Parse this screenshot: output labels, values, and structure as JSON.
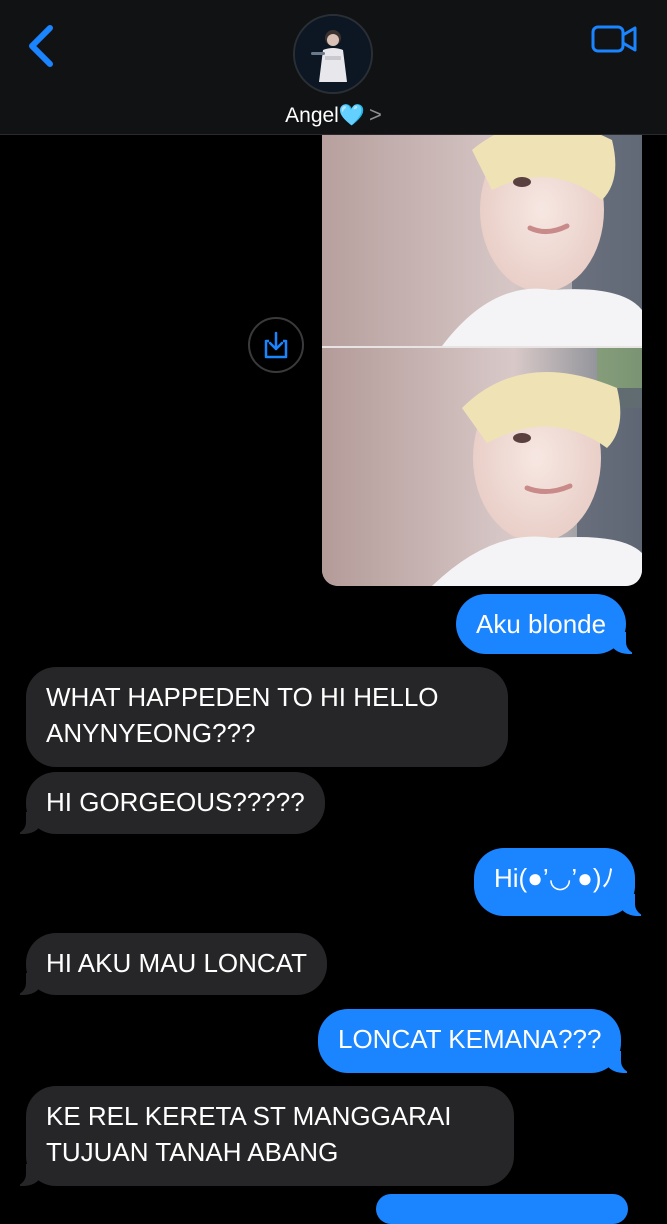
{
  "header": {
    "contact_name": "Angel🩵",
    "chevron": ">",
    "accent_color": "#1b84ff"
  },
  "icons": {
    "back": "chevron-left-icon",
    "video": "video-camera-icon",
    "download": "share-download-icon"
  },
  "messages": [
    {
      "side": "out",
      "text": "Aku blonde"
    },
    {
      "side": "in",
      "text": "WHAT HAPPEDEN TO HI HELLO ANYNYEONG???"
    },
    {
      "side": "in",
      "text": "HI GORGEOUS?????"
    },
    {
      "side": "out",
      "text": "Hi(●’◡’●)ﾉ"
    },
    {
      "side": "in",
      "text": "HI AKU MAU LONCAT"
    },
    {
      "side": "out",
      "text": "LONCAT KEMANA???"
    },
    {
      "side": "in",
      "text": "KE REL KERETA ST MANGGARAI TUJUAN TANAH ABANG"
    }
  ]
}
